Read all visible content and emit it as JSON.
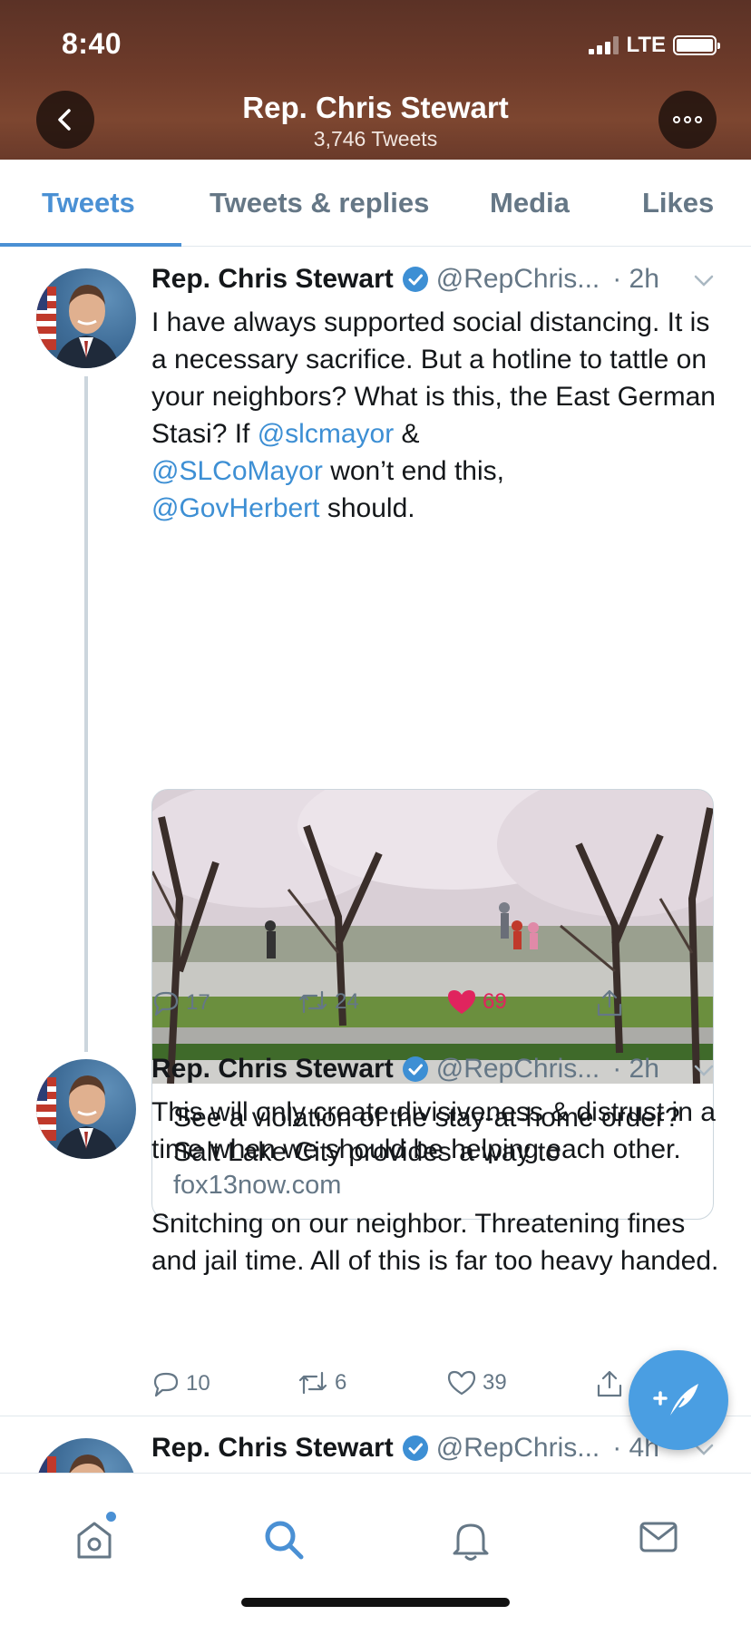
{
  "status_bar": {
    "time": "8:40",
    "network": "LTE"
  },
  "profile": {
    "name": "Rep. Chris Stewart",
    "tweet_count": "3,746 Tweets"
  },
  "tabs": [
    {
      "label": "Tweets",
      "active": true
    },
    {
      "label": "Tweets & replies",
      "active": false
    },
    {
      "label": "Media",
      "active": false
    },
    {
      "label": "Likes",
      "active": false
    }
  ],
  "tweets": [
    {
      "name": "Rep. Chris Stewart",
      "handle": "@RepChris...",
      "time": "· 2h",
      "text_parts": {
        "p1": "I have always supported social distancing. It is a necessary sacrifice. But a hotline to tattle on your neighbors? What is this, the East German Stasi? If ",
        "m1": "@slcmayor",
        "p2": " & ",
        "m2": "@SLCoMayor",
        "p3": " won’t end this, ",
        "m3": "@GovHerbert",
        "p4": " should."
      },
      "card": {
        "title": "See a violation of the stay-at-home order? Salt Lake City provides a way to",
        "domain": "fox13now.com"
      },
      "replies": "17",
      "retweets": "24",
      "likes": "69",
      "liked": true
    },
    {
      "name": "Rep. Chris Stewart",
      "handle": "@RepChris...",
      "time": "· 2h",
      "text_p1": "This will only create divisiveness & distrust in a time when we should be helping each other.",
      "text_p2": "Snitching on our neighbor. Threatening fines and jail time. All of this is far too heavy handed.",
      "replies": "10",
      "retweets": "6",
      "likes": "39",
      "liked": false
    },
    {
      "name": "Rep. Chris Stewart",
      "handle": "@RepChris...",
      "time": "· 4h"
    }
  ],
  "colors": {
    "accent": "#4a90d4",
    "like": "#e0245e",
    "muted": "#657786"
  },
  "icons": {
    "nav": [
      "home-icon",
      "search-icon",
      "bell-icon",
      "mail-icon"
    ],
    "header": [
      "back-arrow-icon",
      "more-icon"
    ],
    "compose": "compose-feather-icon"
  }
}
